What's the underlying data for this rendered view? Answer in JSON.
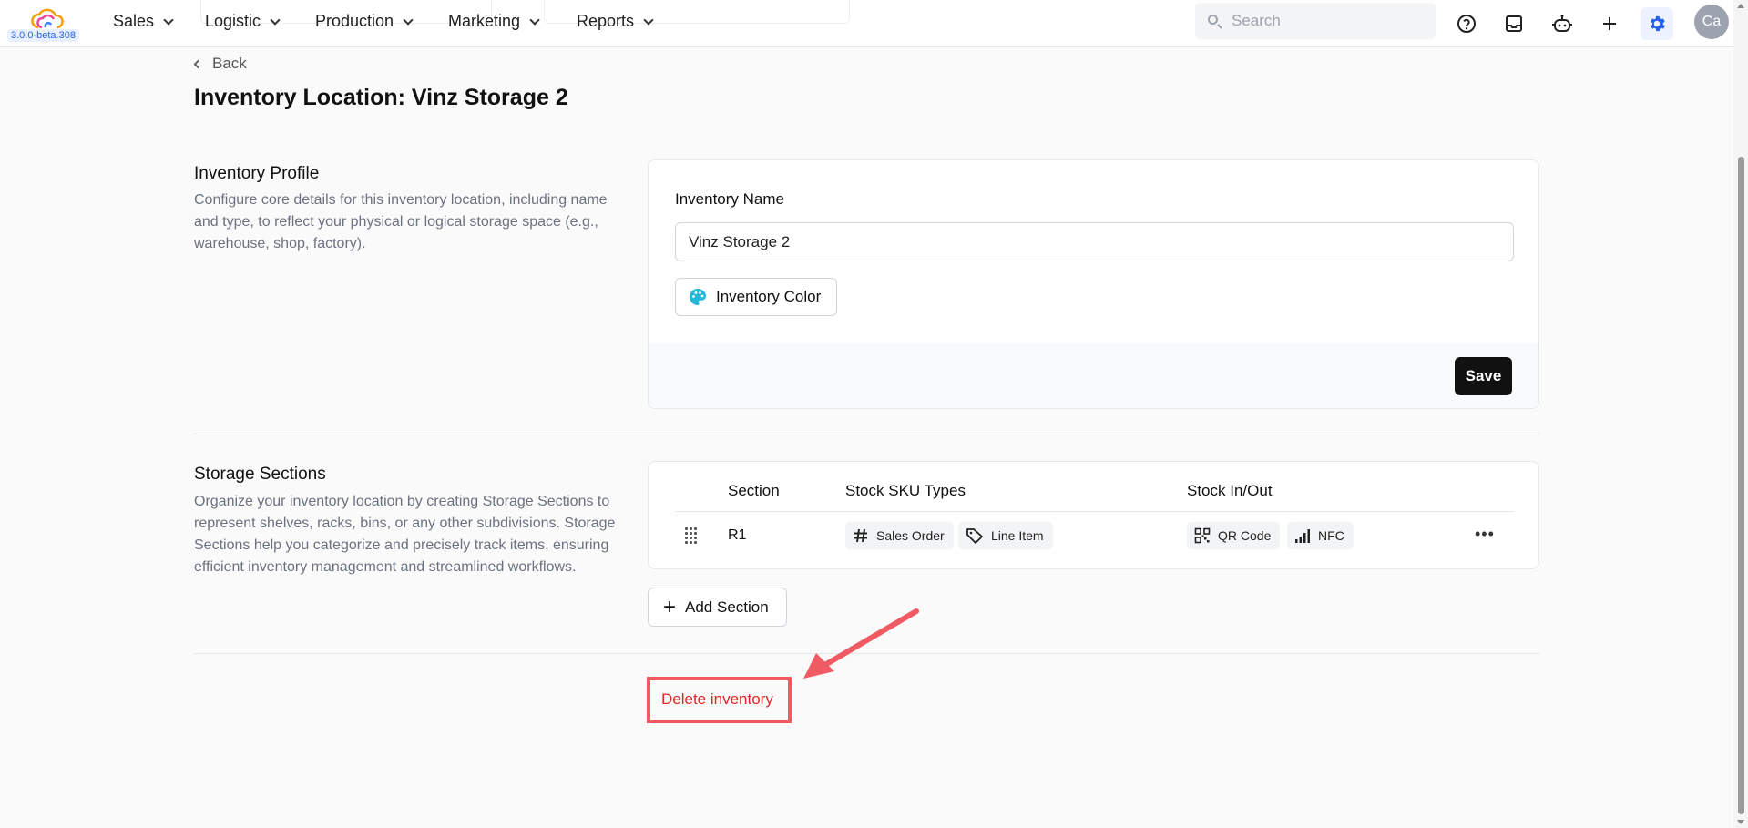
{
  "app": {
    "version": "3.0.0-beta.308"
  },
  "nav": {
    "items": [
      {
        "label": "Sales"
      },
      {
        "label": "Logistic"
      },
      {
        "label": "Production"
      },
      {
        "label": "Marketing"
      },
      {
        "label": "Reports"
      }
    ],
    "search_placeholder": "Search",
    "icons": [
      "help-circle-icon",
      "inbox-icon",
      "robot-icon",
      "plus-icon",
      "gear-icon"
    ],
    "avatar_initials": "Ca"
  },
  "page": {
    "back_label": "Back",
    "title": "Inventory Location: Vinz Storage 2"
  },
  "profile": {
    "title": "Inventory Profile",
    "description": "Configure core details for this inventory location, including name and type, to reflect your physical or logical storage space (e.g., warehouse, shop, factory).",
    "name_label": "Inventory Name",
    "name_value": "Vinz Storage 2",
    "color_button": "Inventory Color",
    "save_button": "Save"
  },
  "storage": {
    "title": "Storage Sections",
    "description": "Organize your inventory location by creating Storage Sections to represent shelves, racks, bins, or any other subdivisions. Storage Sections help you categorize and precisely track items, ensuring efficient inventory management and streamlined workflows.",
    "columns": [
      "Section",
      "Stock SKU Types",
      "Stock In/Out"
    ],
    "rows": [
      {
        "section": "R1",
        "sku_types": [
          "Sales Order",
          "Line Item"
        ],
        "stock_in_out": [
          "QR Code",
          "NFC"
        ]
      }
    ],
    "add_button": "Add Section"
  },
  "danger": {
    "delete_button": "Delete inventory"
  },
  "colors": {
    "accent": "#2563eb",
    "danger": "#dc2626",
    "highlight_box": "#ef5a63",
    "primary_button": "#111111"
  }
}
